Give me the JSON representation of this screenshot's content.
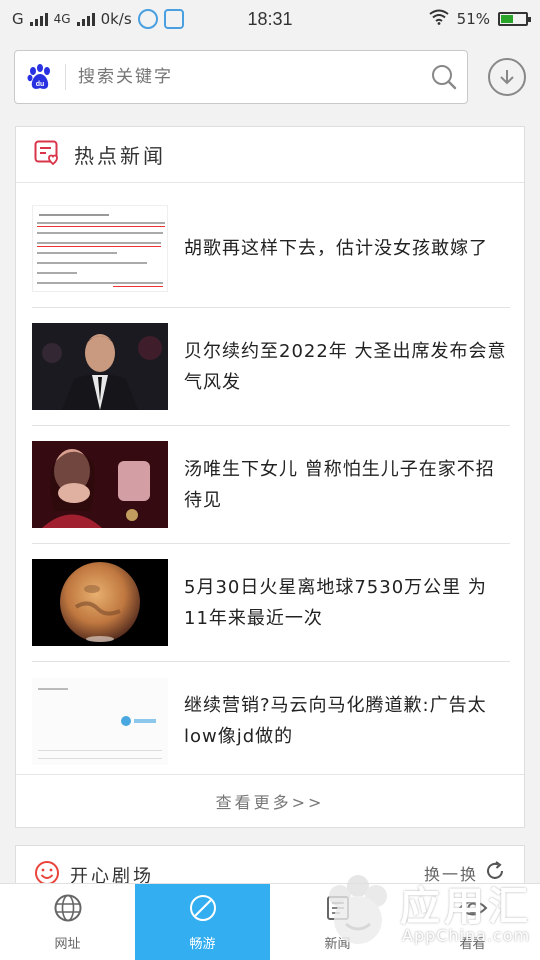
{
  "status_bar": {
    "carrier_left": "G",
    "network": "4G",
    "speed": "0k/s",
    "time": "18:31",
    "battery_percent": "51%",
    "battery_level": 0.51
  },
  "search": {
    "placeholder": "搜索关键字"
  },
  "news_section": {
    "title": "热点新闻",
    "items": [
      {
        "title": "胡歌再这样下去，估计没女孩敢嫁了"
      },
      {
        "title": "贝尔续约至2022年 大圣出席发布会意气风发"
      },
      {
        "title": "汤唯生下女儿 曾称怕生儿子在家不招待见"
      },
      {
        "title": "5月30日火星离地球7530万公里 为11年来最近一次"
      },
      {
        "title": "继续营销?马云向马化腾道歉:广告太low像jd做的"
      }
    ],
    "more_label": "查看更多>>"
  },
  "fun_section": {
    "title": "开心剧场",
    "shuffle_label": "换一换"
  },
  "bottom_nav": {
    "items": [
      {
        "label": "网址"
      },
      {
        "label": "畅游"
      },
      {
        "label": "新闻"
      },
      {
        "label": "看看"
      }
    ]
  },
  "watermark": {
    "main": "应用汇",
    "sub": "AppChina.com"
  },
  "colors": {
    "accent": "#33aef0",
    "baidu_blue": "#2932e1",
    "news_icon": "#d9344a",
    "fun_icon": "#e9443a"
  }
}
